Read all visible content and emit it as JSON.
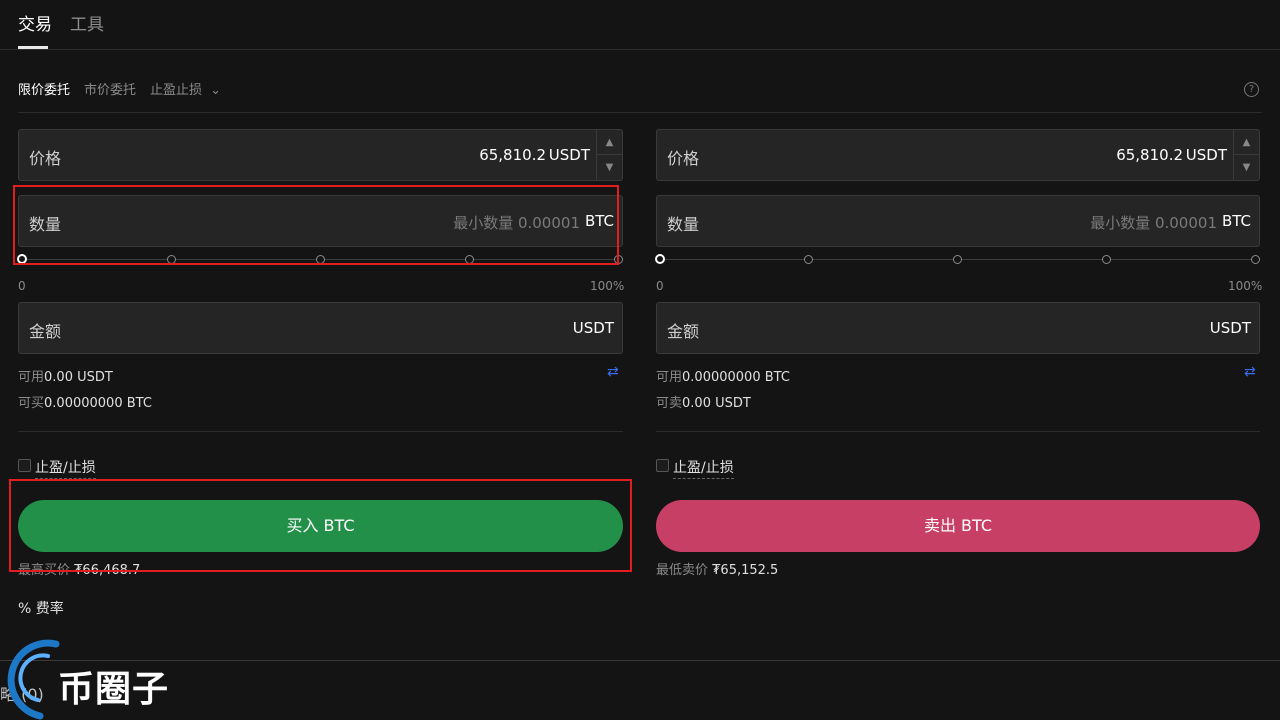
{
  "top_tabs": [
    {
      "label": "交易",
      "active": true
    },
    {
      "label": "工具",
      "active": false
    }
  ],
  "order_types": {
    "limit": "限价委托",
    "market": "市价委托",
    "tpsl": "止盈止损",
    "tpsl_chevron": "⌄"
  },
  "help_icon": "?",
  "buy": {
    "price_label": "价格",
    "price_value": "65,810.2",
    "price_unit": "USDT",
    "qty_label": "数量",
    "qty_placeholder": "最小数量 0.00001",
    "qty_unit": "BTC",
    "slider_min": "0",
    "slider_max": "100%",
    "slider_percent": 0,
    "amount_label": "金额",
    "amount_unit": "USDT",
    "available_label": "可用",
    "available_value": "0.00 USDT",
    "can_trade_label": "可买",
    "can_trade_value": "0.00000000 BTC",
    "tpsl_label": "止盈/止损",
    "tpsl_checked": false,
    "button_label": "买入 BTC",
    "best_price_label": "最高买价",
    "best_price_value": "₮66,468.7"
  },
  "sell": {
    "price_label": "价格",
    "price_value": "65,810.2",
    "price_unit": "USDT",
    "qty_label": "数量",
    "qty_placeholder": "最小数量 0.00001",
    "qty_unit": "BTC",
    "slider_min": "0",
    "slider_max": "100%",
    "slider_percent": 0,
    "amount_label": "金额",
    "amount_unit": "USDT",
    "available_label": "可用",
    "available_value": "0.00000000 BTC",
    "can_trade_label": "可卖",
    "can_trade_value": "0.00 USDT",
    "tpsl_label": "止盈/止损",
    "tpsl_checked": false,
    "button_label": "卖出 BTC",
    "best_price_label": "最低卖价",
    "best_price_value": "₮65,152.5"
  },
  "fee_label": "% 费率",
  "bottom_tab_label": "策略 (0)",
  "watermark_text": "币圈子",
  "colors": {
    "buy": "#23904a",
    "sell": "#c83f66",
    "highlight": "#e21d1d",
    "swap_icon": "#3a6cf0"
  }
}
